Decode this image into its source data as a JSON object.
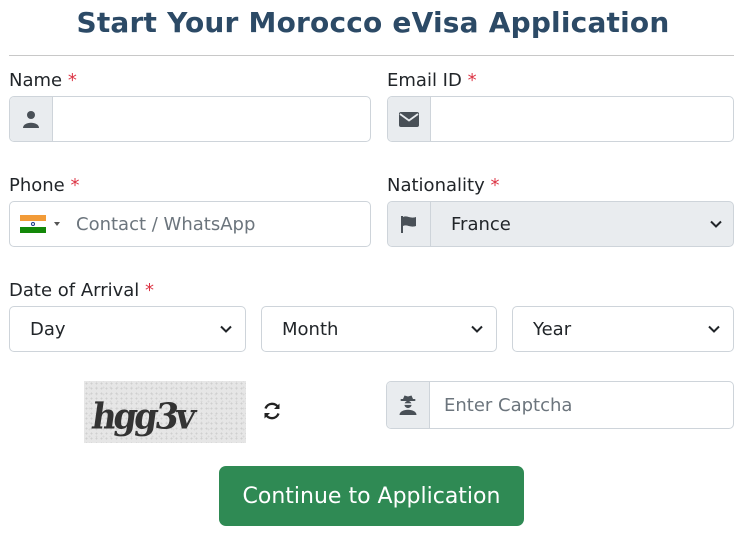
{
  "form": {
    "title": "Start Your Morocco eVisa Application",
    "required_mark": "*",
    "name": {
      "label": "Name",
      "value": "",
      "icon": "user-icon"
    },
    "email": {
      "label": "Email ID",
      "value": "",
      "icon": "envelope-icon"
    },
    "phone": {
      "label": "Phone",
      "placeholder": "Contact / WhatsApp",
      "country_flag": "india-flag"
    },
    "nationality": {
      "label": "Nationality",
      "selected": "France",
      "icon": "flag-icon"
    },
    "arrival": {
      "label": "Date of Arrival",
      "day": "Day",
      "month": "Month",
      "year": "Year"
    },
    "captcha": {
      "image_text": "hgg3v",
      "placeholder": "Enter Captcha",
      "icon": "user-secret-icon",
      "refresh_icon": "refresh-icon"
    },
    "submit_label": "Continue to Application"
  },
  "colors": {
    "title": "#2c4a66",
    "required": "#dc3545",
    "button": "#2f8a54",
    "addon_bg": "#e9ecef",
    "border": "#ced4da"
  }
}
